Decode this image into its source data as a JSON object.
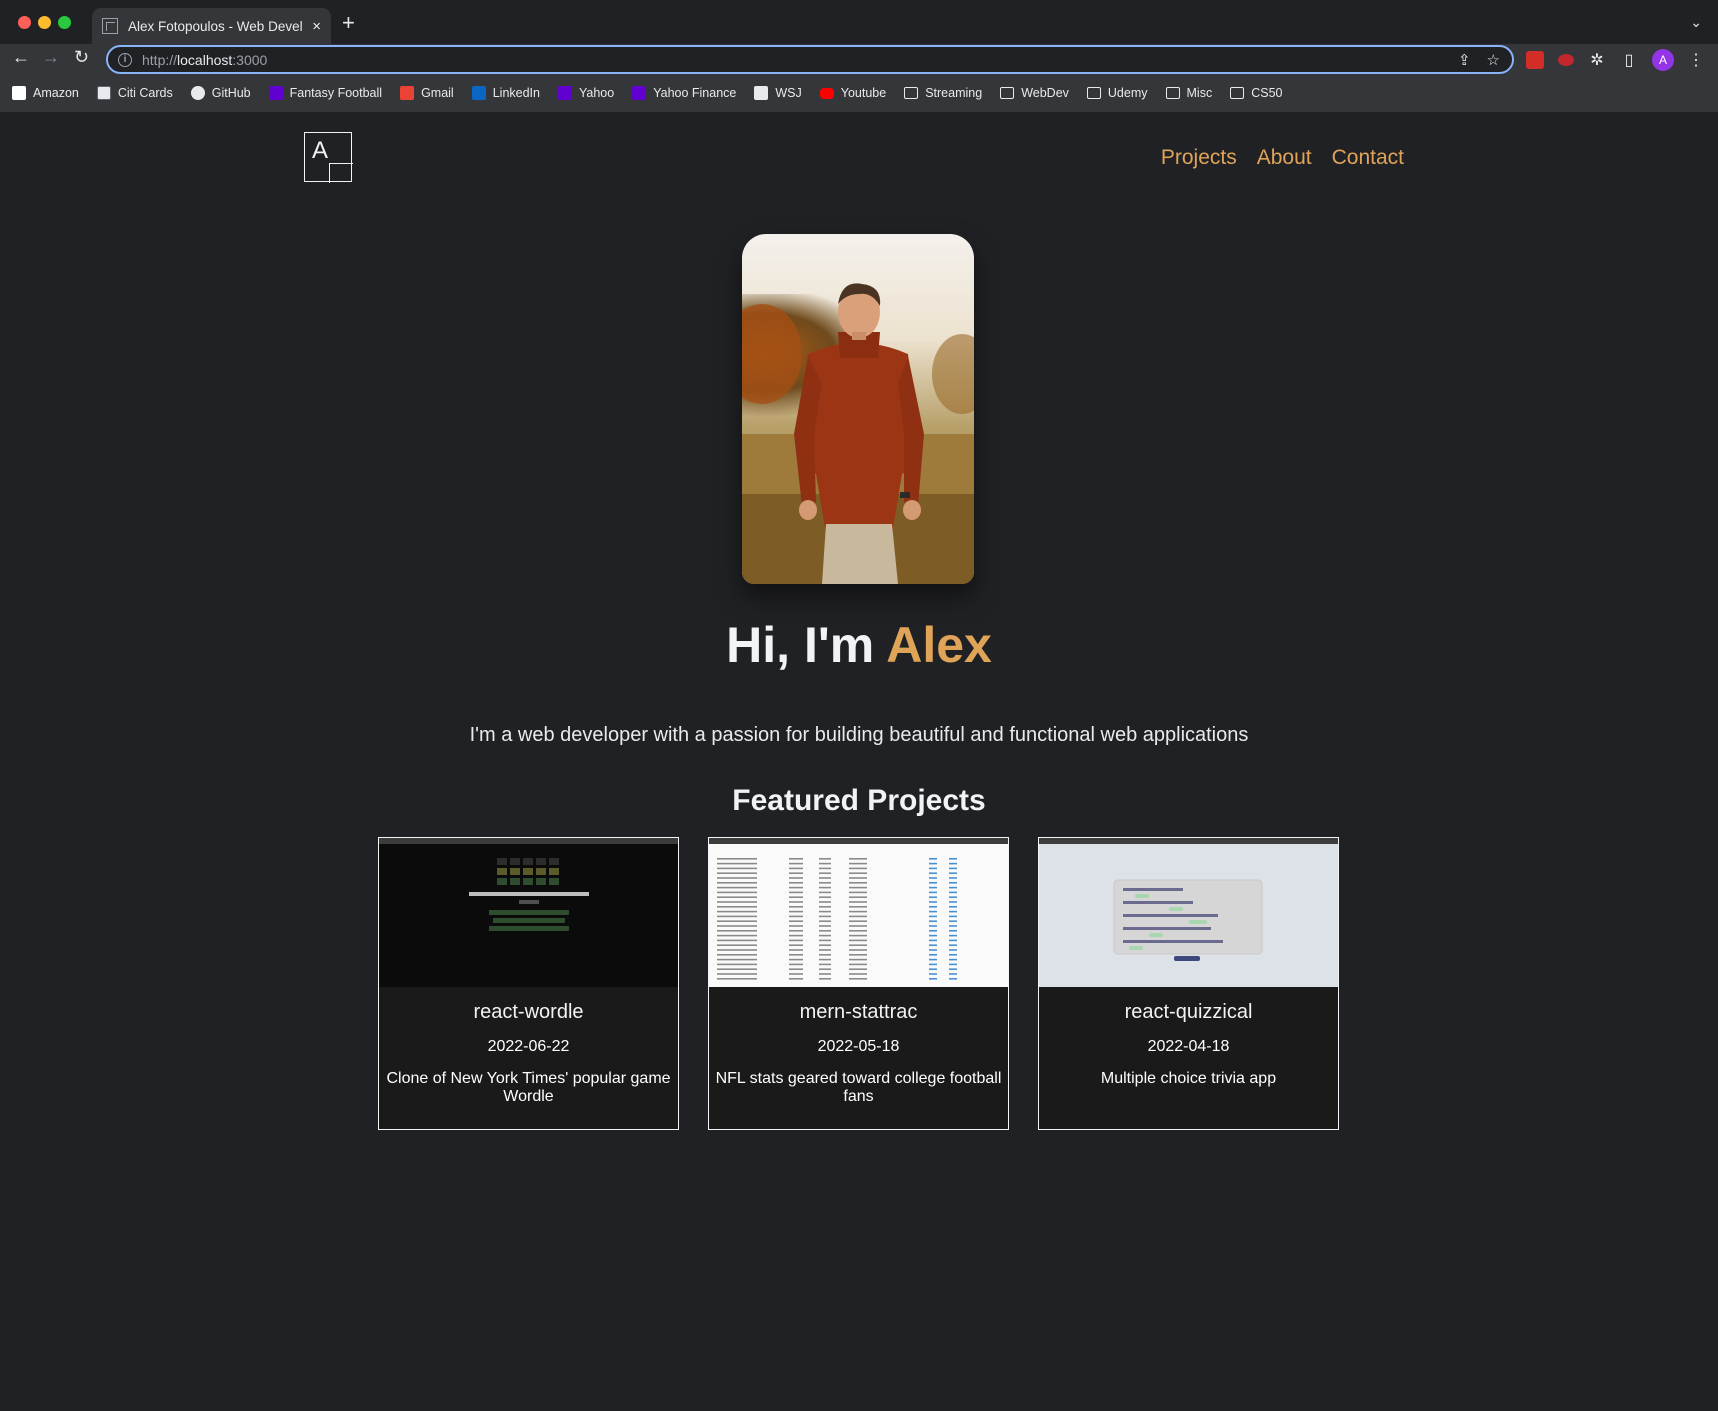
{
  "browser": {
    "tab_title": "Alex Fotopoulos - Web Developer",
    "tab_close": "×",
    "new_tab": "+",
    "url_prefix": "http://",
    "url_host": "localhost",
    "url_port": ":3000",
    "profile_initial": "A",
    "bookmarks": [
      {
        "label": "Amazon",
        "icon": "amazon-icon"
      },
      {
        "label": "Citi Cards",
        "icon": "citi-icon"
      },
      {
        "label": "GitHub",
        "icon": "github-icon"
      },
      {
        "label": "Fantasy Football",
        "icon": "yahoo-icon"
      },
      {
        "label": "Gmail",
        "icon": "gmail-icon"
      },
      {
        "label": "LinkedIn",
        "icon": "linkedin-icon"
      },
      {
        "label": "Yahoo",
        "icon": "yahoo-icon"
      },
      {
        "label": "Yahoo Finance",
        "icon": "yahoo-icon"
      },
      {
        "label": "WSJ",
        "icon": "wsj-icon"
      },
      {
        "label": "Youtube",
        "icon": "youtube-icon"
      },
      {
        "label": "Streaming",
        "icon": "folder-icon"
      },
      {
        "label": "WebDev",
        "icon": "folder-icon"
      },
      {
        "label": "Udemy",
        "icon": "folder-icon"
      },
      {
        "label": "Misc",
        "icon": "folder-icon"
      },
      {
        "label": "CS50",
        "icon": "folder-icon"
      }
    ]
  },
  "site": {
    "logo_text": "A",
    "nav": {
      "projects": "Projects",
      "about": "About",
      "contact": "Contact"
    },
    "hero_prefix": "Hi, I'm ",
    "hero_name": "Alex",
    "tagline": "I'm a web developer with a passion for building beautiful and functional web applications",
    "featured_heading": "Featured Projects",
    "projects": [
      {
        "title": "react-wordle",
        "date": "2022-06-22",
        "description": "Clone of New York Times' popular game Wordle"
      },
      {
        "title": "mern-stattrac",
        "date": "2022-05-18",
        "description": "NFL stats geared toward college football fans"
      },
      {
        "title": "react-quizzical",
        "date": "2022-04-18",
        "description": "Multiple choice trivia app"
      }
    ]
  },
  "colors": {
    "background": "#202124",
    "accent": "#e0a458",
    "card_border": "#f1f3f4"
  }
}
